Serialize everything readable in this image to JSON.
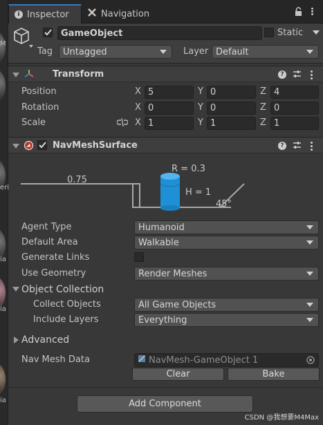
{
  "tabs": [
    {
      "label": "Inspector",
      "icon": "info-icon"
    },
    {
      "label": "Navigation",
      "icon": "navigation-icon"
    }
  ],
  "left_panel": {
    "visible_texts": [
      "M",
      "eri",
      "ia",
      "ia",
      "ia"
    ]
  },
  "gameobject": {
    "enabled": true,
    "name": "GameObject",
    "static_label": "Static",
    "static_checked": false,
    "tag_label": "Tag",
    "tag_value": "Untagged",
    "layer_label": "Layer",
    "layer_value": "Default"
  },
  "transform": {
    "title": "Transform",
    "rows": [
      {
        "label": "Position",
        "x": "5",
        "y": "0",
        "z": "4"
      },
      {
        "label": "Rotation",
        "x": "0",
        "y": "0",
        "z": "0"
      },
      {
        "label": "Scale",
        "x": "1",
        "y": "1",
        "z": "1"
      }
    ],
    "axis_labels": [
      "X",
      "Y",
      "Z"
    ]
  },
  "navmesh": {
    "title": "NavMeshSurface",
    "enabled": true,
    "diagram": {
      "step_height": "0.75",
      "radius": "R = 0.3",
      "height": "H = 1",
      "slope": "45°",
      "agent_color": "#1e90d6"
    },
    "agent_type_label": "Agent Type",
    "agent_type_value": "Humanoid",
    "default_area_label": "Default Area",
    "default_area_value": "Walkable",
    "generate_links_label": "Generate Links",
    "generate_links_checked": false,
    "use_geometry_label": "Use Geometry",
    "use_geometry_value": "Render Meshes",
    "object_collection_label": "Object Collection",
    "collect_objects_label": "Collect Objects",
    "collect_objects_value": "All Game Objects",
    "include_layers_label": "Include Layers",
    "include_layers_value": "Everything",
    "advanced_label": "Advanced",
    "nav_mesh_data_label": "Nav Mesh Data",
    "nav_mesh_data_value": "NavMesh-GameObject 1",
    "clear_label": "Clear",
    "bake_label": "Bake"
  },
  "add_component_label": "Add Component",
  "watermark": "CSDN @我想要M4Max",
  "colors": {
    "accent_tab": "#3a79bb",
    "checkmark": "#d8d8d8"
  }
}
